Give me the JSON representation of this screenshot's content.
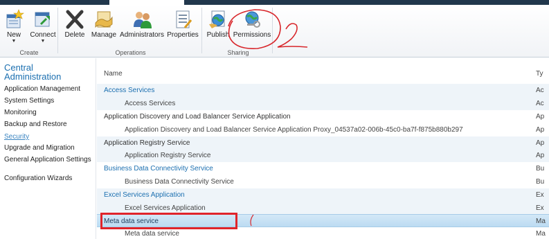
{
  "ribbon": {
    "groups": [
      {
        "label": "Create"
      },
      {
        "label": "Operations"
      },
      {
        "label": "Sharing"
      }
    ],
    "buttons": {
      "new": "New",
      "connect": "Connect",
      "delete": "Delete",
      "manage": "Manage",
      "administrators": "Administrators",
      "properties": "Properties",
      "publish": "Publish",
      "permissions": "Permissions"
    },
    "dropdown_arrow": "▼"
  },
  "leftnav": {
    "heading": "Central Administration",
    "items": [
      "Application Management",
      "System Settings",
      "Monitoring",
      "Backup and Restore",
      "Security",
      "Upgrade and Migration",
      "General Application Settings",
      "Configuration Wizards"
    ]
  },
  "table": {
    "columns": [
      "Name",
      "Ty"
    ],
    "rows": [
      {
        "name": "Access Services",
        "type": "Ac"
      },
      {
        "name": "Access Services",
        "type": "Ac"
      },
      {
        "name": "Application Discovery and Load Balancer Service Application",
        "type": "Ap"
      },
      {
        "name": "Application Discovery and Load Balancer Service Application Proxy_04537a02-006b-45c0-ba7f-f875b880b297",
        "type": "Ap"
      },
      {
        "name": "Application Registry Service",
        "type": "Ap"
      },
      {
        "name": "Application Registry Service",
        "type": "Ap"
      },
      {
        "name": "Business Data Connectivity Service",
        "type": "Bu"
      },
      {
        "name": "Business Data Connectivity Service",
        "type": "Bu"
      },
      {
        "name": "Excel Services Application",
        "type": "Ex"
      },
      {
        "name": "Excel Services Application",
        "type": "Ex"
      },
      {
        "name": "Meta data service",
        "type": "Ma"
      },
      {
        "name": "Meta data service",
        "type": "Ma"
      }
    ]
  },
  "colors": {
    "accent": "#1b6fb0",
    "highlight": "#bcdbf2",
    "annotation": "#e0242a"
  }
}
